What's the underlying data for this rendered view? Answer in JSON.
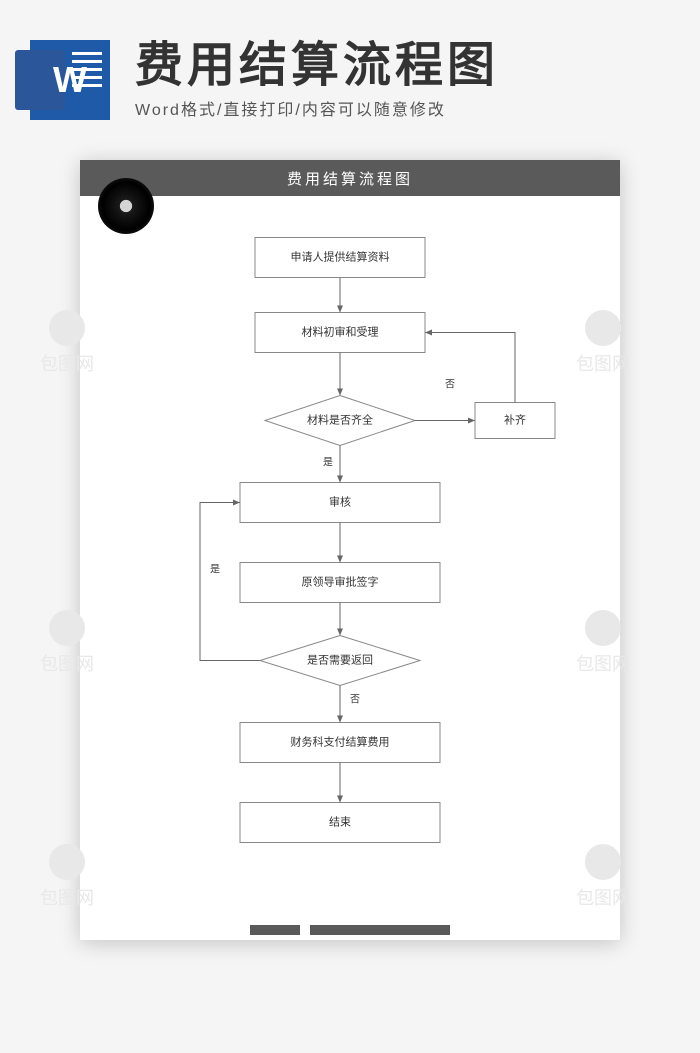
{
  "header": {
    "word_letter": "W",
    "main_title": "费用结算流程图",
    "subtitle": "Word格式/直接打印/内容可以随意修改"
  },
  "page": {
    "title": "费用结算流程图"
  },
  "watermark_text": "包图网",
  "flowchart": {
    "nodes": {
      "n1": "申请人提供结算资料",
      "n2": "材料初审和受理",
      "n3": "材料是否齐全",
      "n3a": "补齐",
      "n4": "审核",
      "n5": "原领导审批签字",
      "n6": "是否需要返回",
      "n7": "财务科支付结算费用",
      "n8": "结束"
    },
    "labels": {
      "yes": "是",
      "no": "否"
    }
  }
}
